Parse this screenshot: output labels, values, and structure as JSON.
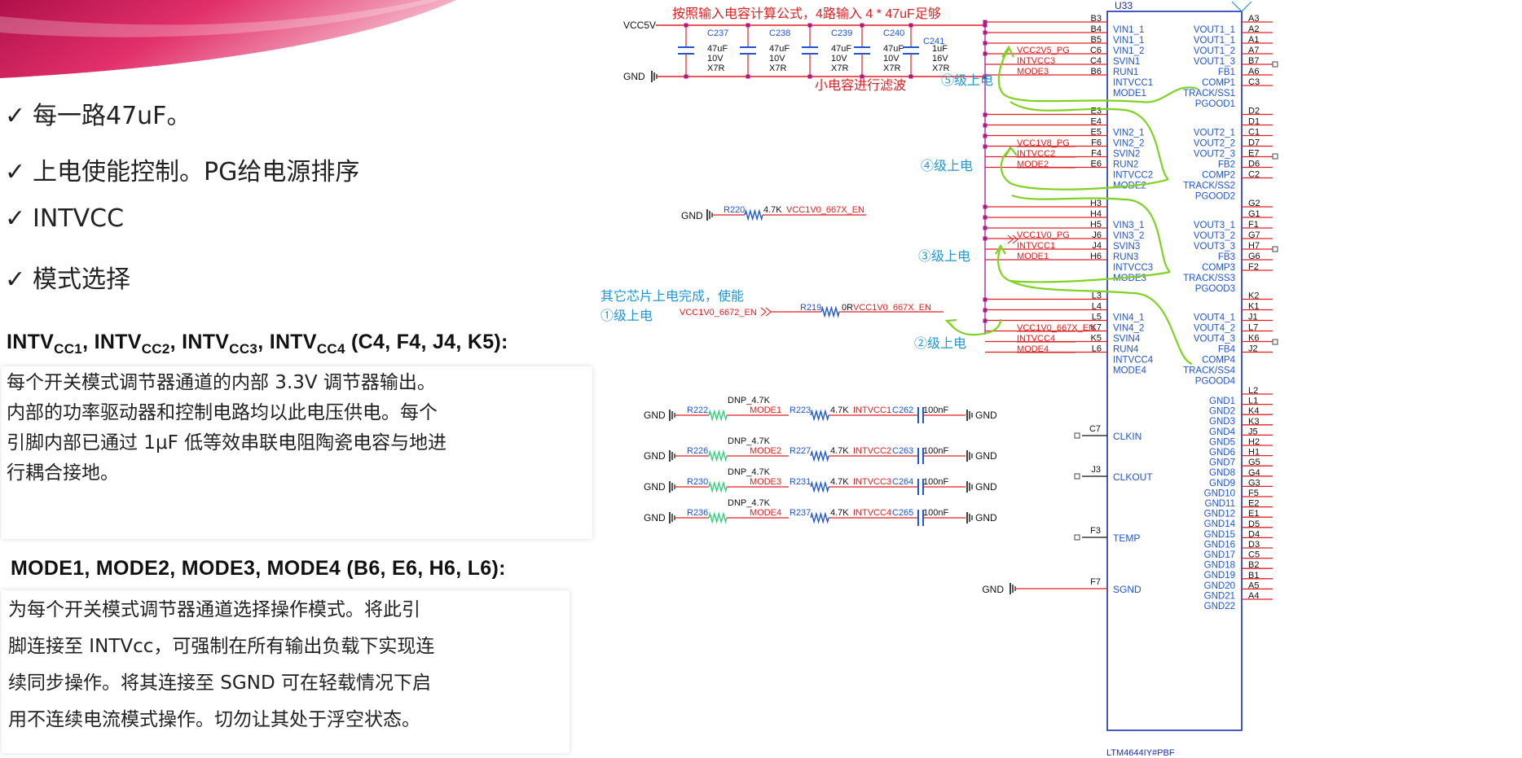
{
  "slide": {
    "bullets": [
      "每一路47uF。",
      "上电使能控制。PG给电源排序",
      "INTVCC",
      "模式选择"
    ],
    "check_glyph": "✓",
    "intvcc_header": {
      "parts": [
        {
          "t": "INTV",
          "s": "CC1"
        },
        {
          "t": ", INTV",
          "s": "CC2"
        },
        {
          "t": ", INTV",
          "s": "CC3"
        },
        {
          "t": ", INTV",
          "s": "CC4"
        },
        {
          "t": " (C4, F4, J4, K5):",
          "s": ""
        }
      ]
    },
    "intvcc_desc": [
      "每个开关模式调节器通道的内部 3.3V 调节器输出。",
      "内部的功率驱动器和控制电路均以此电压供电。每个",
      "引脚内部已通过 1μF 低等效串联电阻陶瓷电容与地进",
      "行耦合接地。"
    ],
    "mode_header": "MODE1, MODE2, MODE3, MODE4 (B6, E6, H6, L6):",
    "mode_desc": [
      "为每个开关模式调节器通道选择操作模式。将此引",
      "脚连接至 INTVcc，可强制在所有输出负载下实现连",
      "续同步操作。将其连接至 SGND 可在轻载情况下启",
      "用不连续电流模式操作。切勿让其处于浮空状态。"
    ]
  },
  "schematic": {
    "chip_ref": "U33",
    "chip_part": "LTM4644IY#PBF",
    "vcc_label": "VCC5V",
    "gnd_label": "GND",
    "notes": {
      "input_cap": "按照输入电容计算公式，4路输入 4 * 47uF足够",
      "filter": "小电容进行滤波",
      "stage5": "⑤级上电",
      "stage4": "④级上电",
      "stage3": "③级上电",
      "stage2": "②级上电",
      "enable": "其它芯片上电完成，使能",
      "stage1": "①级上电"
    },
    "caps": [
      {
        "ref": "C237",
        "value": "47uF",
        "volt": "10V",
        "diel": "X7R"
      },
      {
        "ref": "C238",
        "value": "47uF",
        "volt": "10V",
        "diel": "X7R"
      },
      {
        "ref": "C239",
        "value": "47uF",
        "volt": "10V",
        "diel": "X7R"
      },
      {
        "ref": "C240",
        "value": "47uF",
        "volt": "10V",
        "diel": "X7R"
      },
      {
        "ref": "C241",
        "value": "1uF",
        "volt": "16V",
        "diel": "X7R"
      }
    ],
    "left_pins": [
      {
        "num": "B3",
        "name": "VIN1_1"
      },
      {
        "num": "B4",
        "name": "VIN1_1"
      },
      {
        "num": "B5",
        "name": "VIN1_2"
      },
      {
        "num": "C6",
        "name": "SVIN1"
      },
      {
        "num": "C4",
        "name": "RUN1"
      },
      {
        "num": "B6",
        "name": "INTVCC1"
      },
      {
        "num": "",
        "name": "MODE1"
      },
      {
        "num": "E3",
        "name": ""
      },
      {
        "num": "E4",
        "name": "VIN2_1"
      },
      {
        "num": "E5",
        "name": "VIN2_2"
      },
      {
        "num": "F6",
        "name": "SVIN2"
      },
      {
        "num": "F4",
        "name": "RUN2"
      },
      {
        "num": "E6",
        "name": "INTVCC2"
      },
      {
        "num": "",
        "name": "MODE2"
      },
      {
        "num": "H3",
        "name": ""
      },
      {
        "num": "H4",
        "name": "VIN3_1"
      },
      {
        "num": "H5",
        "name": "VIN3_2"
      },
      {
        "num": "J6",
        "name": "SVIN3"
      },
      {
        "num": "J4",
        "name": "RUN3"
      },
      {
        "num": "H6",
        "name": "INTVCC3"
      },
      {
        "num": "",
        "name": "MODE3"
      },
      {
        "num": "L3",
        "name": ""
      },
      {
        "num": "L4",
        "name": "VIN4_1"
      },
      {
        "num": "L5",
        "name": "VIN4_2"
      },
      {
        "num": "K7",
        "name": "SVIN4"
      },
      {
        "num": "K5",
        "name": "RUN4"
      },
      {
        "num": "L6",
        "name": "INTVCC4"
      },
      {
        "num": "",
        "name": "MODE4"
      }
    ],
    "left_nets": [
      {
        "pin": "C6",
        "net": "VCC2V5_PG"
      },
      {
        "pin": "C4",
        "net": "INTVCC3"
      },
      {
        "pin": "B6",
        "net": "MODE3"
      },
      {
        "pin": "F6",
        "net": "VCC1V8_PG"
      },
      {
        "pin": "F4",
        "net": "INTVCC2"
      },
      {
        "pin": "E6",
        "net": "MODE2"
      },
      {
        "pin": "J6",
        "net": "VCC1V0_PG"
      },
      {
        "pin": "J4",
        "net": "INTVCC1"
      },
      {
        "pin": "H6",
        "net": "MODE1"
      },
      {
        "pin": "K7",
        "net": "VCC1V0_667X_EN"
      },
      {
        "pin": "K5",
        "net": "INTVCC4"
      },
      {
        "pin": "L6",
        "net": "MODE4"
      }
    ],
    "right_pins": [
      {
        "num": "A3",
        "name": "VOUT1_1"
      },
      {
        "num": "A2",
        "name": "VOUT1_1"
      },
      {
        "num": "A1",
        "name": "VOUT1_2"
      },
      {
        "num": "A7",
        "name": "VOUT1_3"
      },
      {
        "num": "B7",
        "name": "FB1"
      },
      {
        "num": "A6",
        "name": "COMP1"
      },
      {
        "num": "C3",
        "name": "TRACK/SS1"
      },
      {
        "num": "",
        "name": "PGOOD1"
      },
      {
        "num": "D2",
        "name": ""
      },
      {
        "num": "D1",
        "name": "VOUT2_1"
      },
      {
        "num": "C1",
        "name": "VOUT2_2"
      },
      {
        "num": "D7",
        "name": "VOUT2_3"
      },
      {
        "num": "E7",
        "name": "FB2"
      },
      {
        "num": "D6",
        "name": "COMP2"
      },
      {
        "num": "C2",
        "name": "TRACK/SS2"
      },
      {
        "num": "",
        "name": "PGOOD2"
      },
      {
        "num": "G2",
        "name": ""
      },
      {
        "num": "G1",
        "name": "VOUT3_1"
      },
      {
        "num": "F1",
        "name": "VOUT3_2"
      },
      {
        "num": "G7",
        "name": "VOUT3_3"
      },
      {
        "num": "H7",
        "name": "FB3"
      },
      {
        "num": "G6",
        "name": "COMP3"
      },
      {
        "num": "F2",
        "name": "TRACK/SS3"
      },
      {
        "num": "",
        "name": "PGOOD3"
      },
      {
        "num": "K2",
        "name": ""
      },
      {
        "num": "K1",
        "name": "VOUT4_1"
      },
      {
        "num": "J1",
        "name": "VOUT4_2"
      },
      {
        "num": "L7",
        "name": "VOUT4_3"
      },
      {
        "num": "K6",
        "name": "FB4"
      },
      {
        "num": "J2",
        "name": "COMP4"
      },
      {
        "num": "",
        "name": "TRACK/SS4"
      },
      {
        "num": "",
        "name": "PGOOD4"
      }
    ],
    "gnd_pins": [
      {
        "num": "L2",
        "name": "GND1"
      },
      {
        "num": "L1",
        "name": "GND2"
      },
      {
        "num": "K4",
        "name": "GND3"
      },
      {
        "num": "K3",
        "name": "GND4"
      },
      {
        "num": "J5",
        "name": "GND5"
      },
      {
        "num": "H2",
        "name": "GND6"
      },
      {
        "num": "H1",
        "name": "GND7"
      },
      {
        "num": "G5",
        "name": "GND8"
      },
      {
        "num": "G4",
        "name": "GND9"
      },
      {
        "num": "G3",
        "name": "GND10"
      },
      {
        "num": "F5",
        "name": "GND11"
      },
      {
        "num": "E2",
        "name": "GND12"
      },
      {
        "num": "E1",
        "name": "GND14"
      },
      {
        "num": "D5",
        "name": "GND15"
      },
      {
        "num": "D4",
        "name": "GND16"
      },
      {
        "num": "D3",
        "name": "GND17"
      },
      {
        "num": "C5",
        "name": "GND18"
      },
      {
        "num": "B2",
        "name": "GND19"
      },
      {
        "num": "B1",
        "name": "GND20"
      },
      {
        "num": "A5",
        "name": "GND21"
      },
      {
        "num": "A4",
        "name": "GND22"
      }
    ],
    "misc_pins": [
      {
        "num": "C7",
        "name": "CLKIN"
      },
      {
        "num": "J3",
        "name": "CLKOUT"
      },
      {
        "num": "F3",
        "name": "TEMP"
      },
      {
        "num": "F7",
        "name": "SGND"
      }
    ],
    "r220": {
      "ref": "R220",
      "value": "4.7K",
      "net": "VCC1V0_667X_EN"
    },
    "r219": {
      "ref": "R219",
      "value": "0R",
      "net_in": "VCC1V0_6672_EN",
      "net_out": "VCC1V0_667X_EN"
    },
    "mode_rows": [
      {
        "r_dnp": "R222",
        "dnp": "DNP_4.7K",
        "mode": "MODE1",
        "r_pu": "R223",
        "pu": "4.7K",
        "intvcc": "INTVCC1",
        "cap": "C262",
        "cval": "100nF"
      },
      {
        "r_dnp": "R226",
        "dnp": "DNP_4.7K",
        "mode": "MODE2",
        "r_pu": "R227",
        "pu": "4.7K",
        "intvcc": "INTVCC2",
        "cap": "C263",
        "cval": "100nF"
      },
      {
        "r_dnp": "R230",
        "dnp": "DNP_4.7K",
        "mode": "MODE3",
        "r_pu": "R231",
        "pu": "4.7K",
        "intvcc": "INTVCC3",
        "cap": "C264",
        "cval": "100nF"
      },
      {
        "r_dnp": "R236",
        "dnp": "DNP_4.7K",
        "mode": "MODE4",
        "r_pu": "R237",
        "pu": "4.7K",
        "intvcc": "INTVCC4",
        "cap": "C265",
        "cval": "100nF"
      }
    ]
  }
}
